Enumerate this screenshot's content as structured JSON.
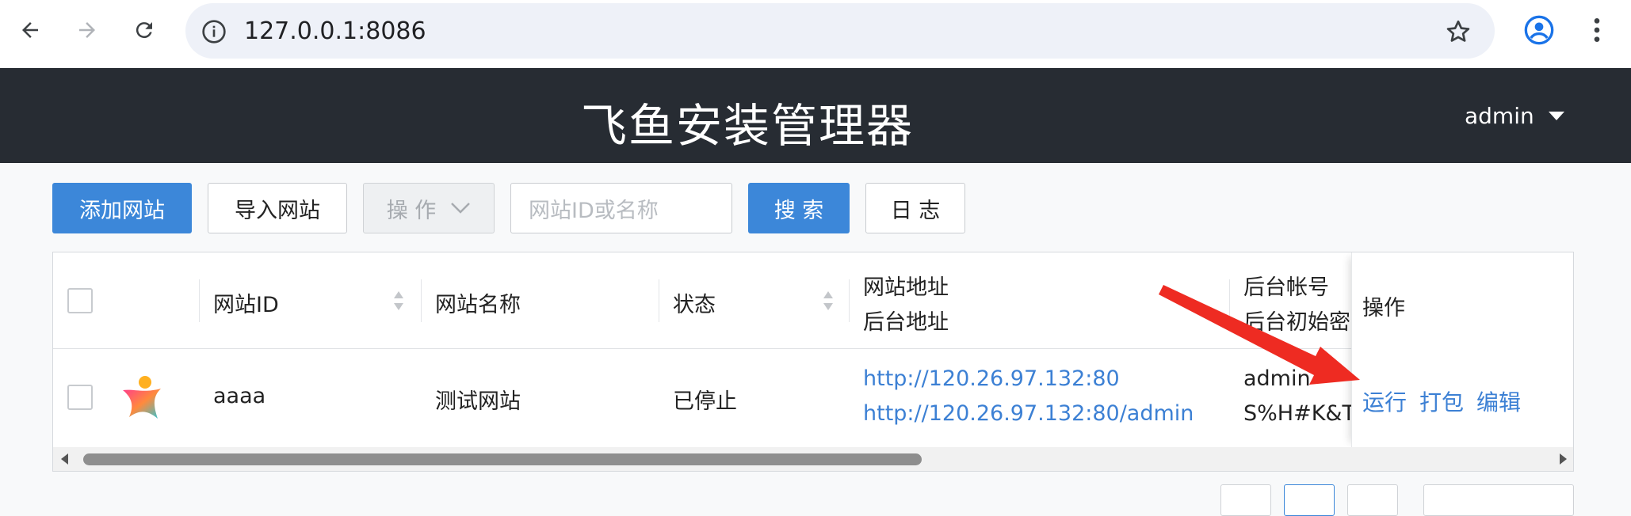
{
  "browser": {
    "url": "127.0.0.1:8086"
  },
  "header": {
    "title": "飞鱼安装管理器",
    "user": "admin"
  },
  "toolbar": {
    "add_site": "添加网站",
    "import_site": "导入网站",
    "operations": "操 作",
    "search_placeholder": "网站ID或名称",
    "search": "搜 索",
    "log": "日 志"
  },
  "table": {
    "headers": {
      "site_id": "网站ID",
      "site_name": "网站名称",
      "status": "状态",
      "site_url": "网站地址",
      "admin_url": "后台地址",
      "admin_account": "后台帐号",
      "admin_password": "后台初始密",
      "actions": "操作"
    },
    "rows": [
      {
        "site_id": "aaaa",
        "site_name": "测试网站",
        "status": "已停止",
        "site_url": "http://120.26.97.132:80",
        "admin_url": "http://120.26.97.132:80/admin",
        "account": "admin",
        "password": "S%H#K&Tb",
        "actions": {
          "run": "运行",
          "pack": "打包",
          "edit": "编辑"
        }
      }
    ]
  },
  "colors": {
    "header_bg": "#272c33",
    "primary": "#3c87d9",
    "link": "#3c80d4",
    "arrow": "#ee2b22"
  }
}
